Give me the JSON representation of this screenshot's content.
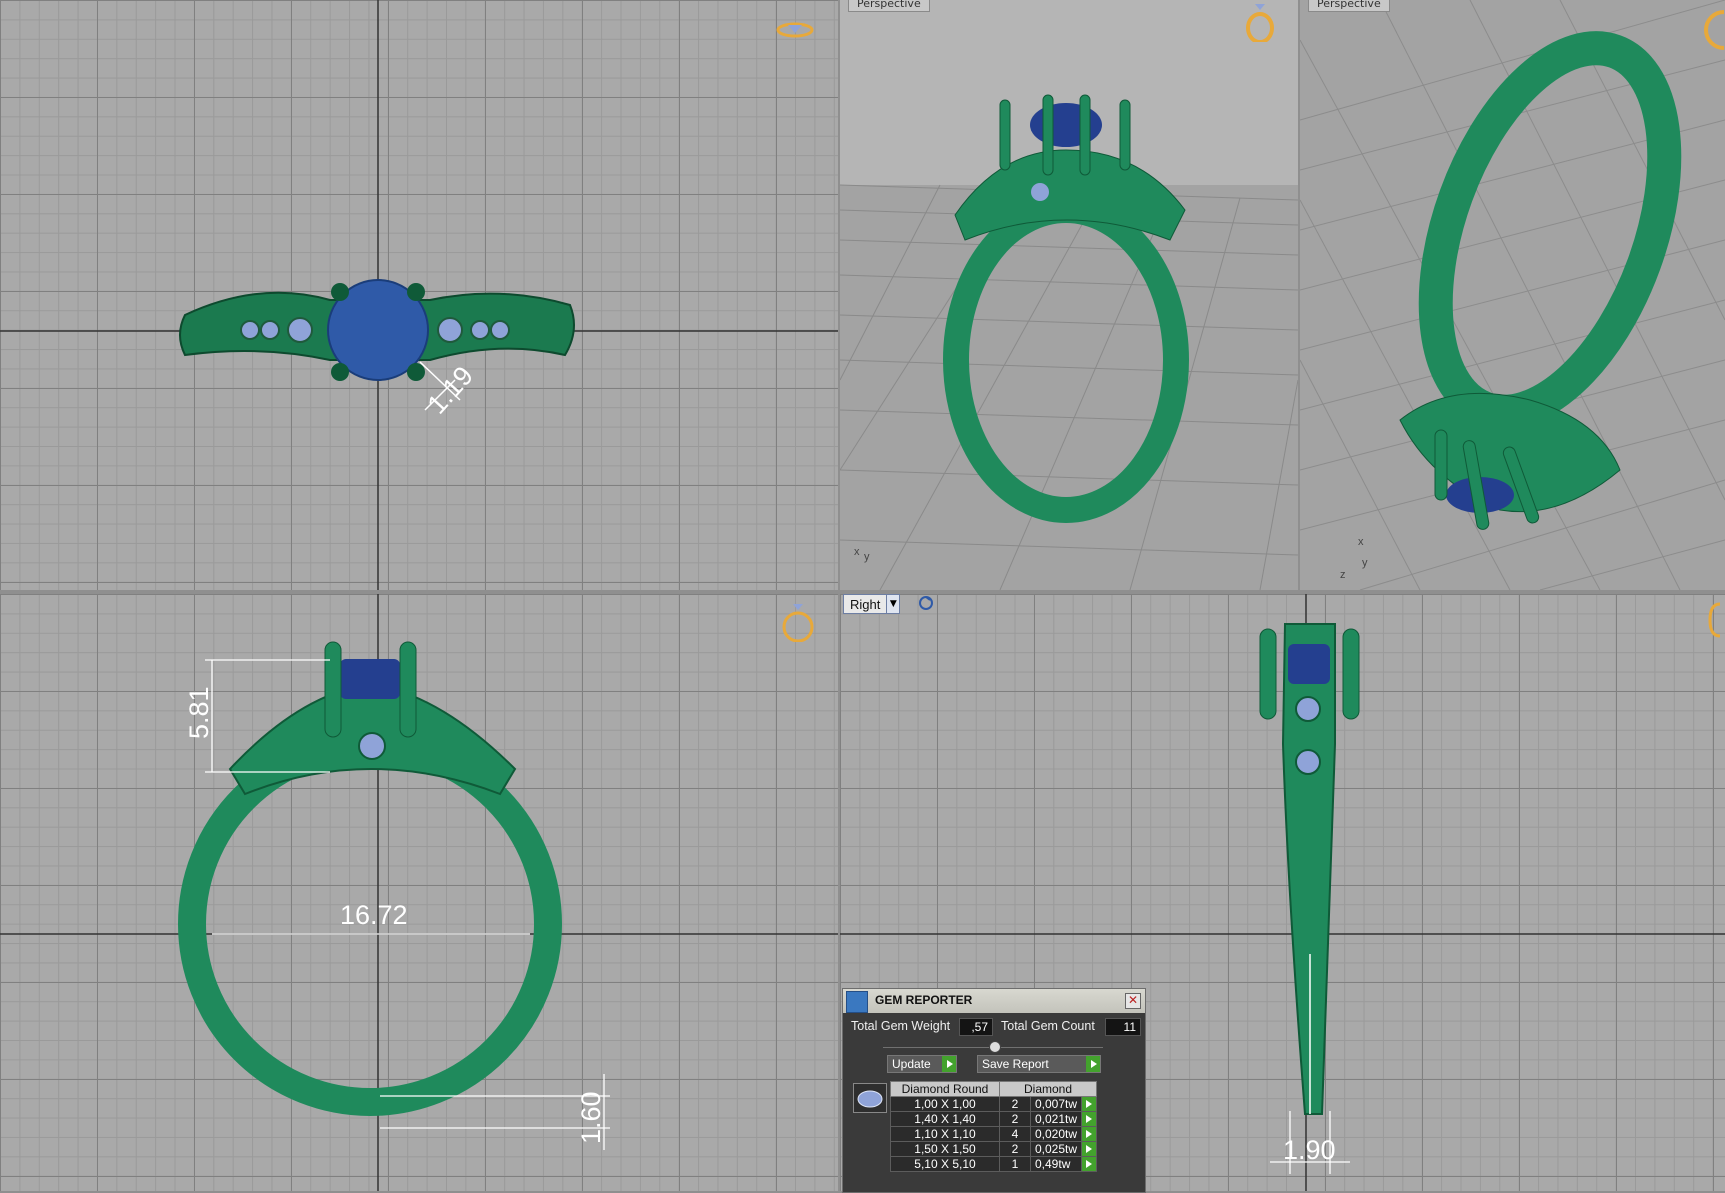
{
  "viewports": {
    "top_left": {
      "dimension": "1.19"
    },
    "top_middle": {
      "label": "Perspective"
    },
    "top_right": {
      "label": "Perspective"
    },
    "bottom_left": {
      "dim_height": "5.81",
      "dim_diameter": "16.72",
      "dim_thickness": "1.60"
    },
    "bottom_right": {
      "view_select": "Right",
      "dim_width": "1.90"
    }
  },
  "gem_reporter": {
    "title": "GEM REPORTER",
    "total_weight_label": "Total Gem Weight",
    "total_weight_value": ",57",
    "total_count_label": "Total Gem Count",
    "total_count_value": "11",
    "update_label": "Update",
    "save_report_label": "Save Report",
    "table_headers": [
      "Diamond Round",
      "Diamond"
    ],
    "rows": [
      {
        "size": "1,00 X 1,00",
        "count": "2",
        "weight": "0,007tw"
      },
      {
        "size": "1,40 X 1,40",
        "count": "2",
        "weight": "0,021tw"
      },
      {
        "size": "1,10 X 1,10",
        "count": "4",
        "weight": "0,020tw"
      },
      {
        "size": "1,50 X 1,50",
        "count": "2",
        "weight": "0,025tw"
      },
      {
        "size": "5,10 X 5,10",
        "count": "1",
        "weight": "0,49tw"
      }
    ]
  },
  "colors": {
    "metal": "#1f8a5c",
    "gem": "#243f8f",
    "grid": "#a9a9a9",
    "nav_ring": "#e8a93a"
  }
}
